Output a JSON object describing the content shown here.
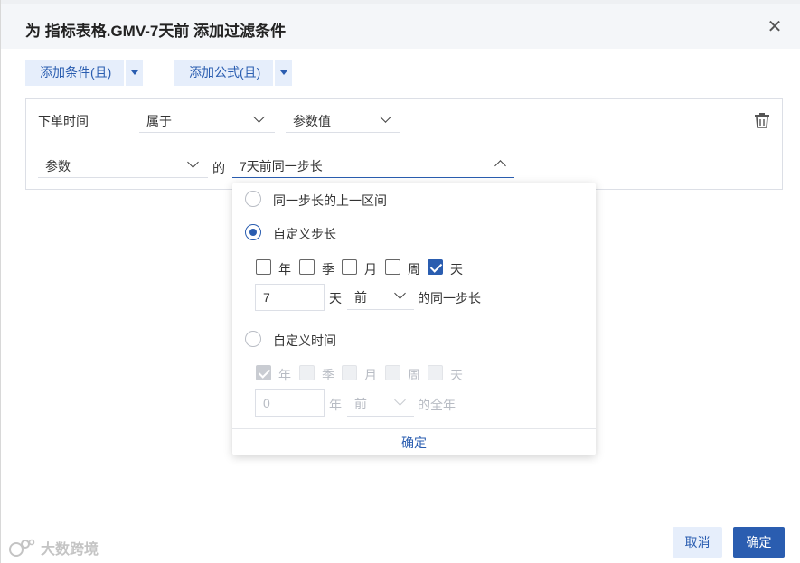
{
  "dialog": {
    "title": "为 指标表格.GMV-7天前 添加过滤条件",
    "close_icon": "close-icon"
  },
  "toolbar": {
    "add_condition_label": "添加条件(且)",
    "add_formula_label": "添加公式(且)"
  },
  "condition": {
    "field_label": "下单时间",
    "operator_value": "属于",
    "value_type_value": "参数值",
    "param_select_value": "参数",
    "of_label": "的",
    "range_select_value": "7天前同一步长",
    "delete_icon": "trash-icon"
  },
  "popup": {
    "option1_label": "同一步长的上一区间",
    "option2_label": "自定义步长",
    "option3_label": "自定义时间",
    "custom_step": {
      "checkboxes": [
        {
          "label": "年",
          "checked": false
        },
        {
          "label": "季",
          "checked": false
        },
        {
          "label": "月",
          "checked": false
        },
        {
          "label": "周",
          "checked": false
        },
        {
          "label": "天",
          "checked": true
        }
      ],
      "amount": "7",
      "unit": "天",
      "direction": "前",
      "suffix": "的同一步长"
    },
    "custom_time": {
      "checkboxes": [
        {
          "label": "年",
          "checked": true
        },
        {
          "label": "季",
          "checked": false
        },
        {
          "label": "月",
          "checked": false
        },
        {
          "label": "周",
          "checked": false
        },
        {
          "label": "天",
          "checked": false
        }
      ],
      "amount": "0",
      "unit": "年",
      "direction": "前",
      "suffix": "的全年"
    },
    "selected_option": "自定义步长",
    "confirm_label": "确定"
  },
  "footer": {
    "cancel_label": "取消",
    "ok_label": "确定"
  },
  "watermark": {
    "text": "大数跨境"
  },
  "colors": {
    "accent": "#2a5db0",
    "accent_light": "#e6eefb",
    "header_bg": "#f4f6f9"
  }
}
